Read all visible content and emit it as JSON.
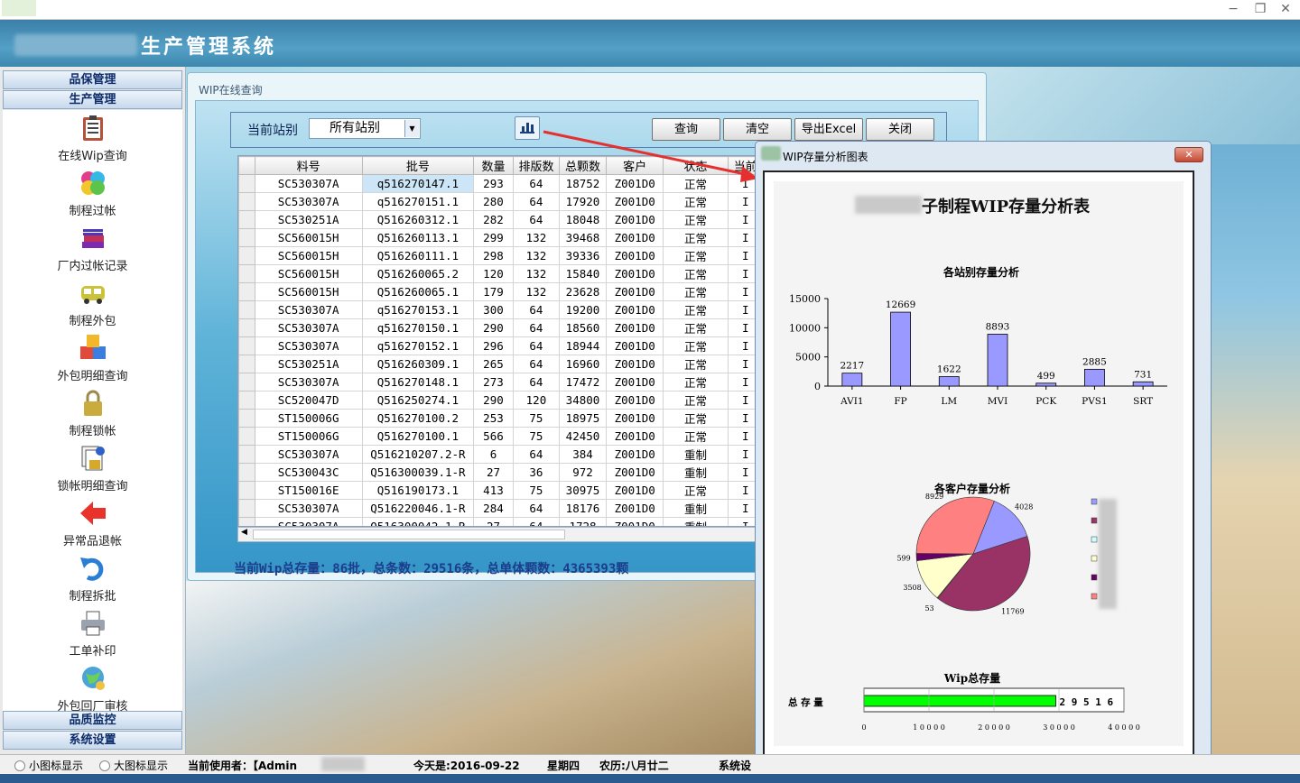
{
  "app": {
    "title": "生产管理系统"
  },
  "sidebar": {
    "sections_top": [
      "品保管理",
      "生产管理"
    ],
    "items": [
      {
        "label": "在线Wip查询",
        "icon": "clipboard-icon"
      },
      {
        "label": "制程过帐",
        "icon": "colored-petals-icon"
      },
      {
        "label": "厂内过帐记录",
        "icon": "book-stack-icon"
      },
      {
        "label": "制程外包",
        "icon": "truck-icon"
      },
      {
        "label": "外包明细查询",
        "icon": "abc-blocks-icon"
      },
      {
        "label": "制程锁帐",
        "icon": "padlock-icon"
      },
      {
        "label": "锁帐明细查询",
        "icon": "locked-documents-icon"
      },
      {
        "label": "异常品退帐",
        "icon": "red-arrow-left-icon"
      },
      {
        "label": "制程拆批",
        "icon": "undo-arrow-icon"
      },
      {
        "label": "工单补印",
        "icon": "printer-icon"
      },
      {
        "label": "外包回厂审核",
        "icon": "globe-people-icon"
      }
    ],
    "sections_bottom": [
      "品质监控",
      "系统设置"
    ]
  },
  "wip": {
    "window_title": "WIP在线查询",
    "station_label": "当前站别",
    "station_value": "所有站别",
    "buttons": {
      "query": "查询",
      "clear": "清空",
      "export": "导出Excel",
      "close": "关闭"
    },
    "columns": [
      "料号",
      "批号",
      "数量",
      "排版数",
      "总颗数",
      "客户",
      "状态",
      "当前"
    ],
    "rows": [
      [
        "SC530307A",
        "q516270147.1",
        "293",
        "64",
        "18752",
        "Z001D0",
        "正常",
        "I"
      ],
      [
        "SC530307A",
        "q516270151.1",
        "280",
        "64",
        "17920",
        "Z001D0",
        "正常",
        "I"
      ],
      [
        "SC530251A",
        "Q516260312.1",
        "282",
        "64",
        "18048",
        "Z001D0",
        "正常",
        "I"
      ],
      [
        "SC560015H",
        "Q516260113.1",
        "299",
        "132",
        "39468",
        "Z001D0",
        "正常",
        "I"
      ],
      [
        "SC560015H",
        "Q516260111.1",
        "298",
        "132",
        "39336",
        "Z001D0",
        "正常",
        "I"
      ],
      [
        "SC560015H",
        "Q516260065.2",
        "120",
        "132",
        "15840",
        "Z001D0",
        "正常",
        "I"
      ],
      [
        "SC560015H",
        "Q516260065.1",
        "179",
        "132",
        "23628",
        "Z001D0",
        "正常",
        "I"
      ],
      [
        "SC530307A",
        "q516270153.1",
        "300",
        "64",
        "19200",
        "Z001D0",
        "正常",
        "I"
      ],
      [
        "SC530307A",
        "q516270150.1",
        "290",
        "64",
        "18560",
        "Z001D0",
        "正常",
        "I"
      ],
      [
        "SC530307A",
        "q516270152.1",
        "296",
        "64",
        "18944",
        "Z001D0",
        "正常",
        "I"
      ],
      [
        "SC530251A",
        "Q516260309.1",
        "265",
        "64",
        "16960",
        "Z001D0",
        "正常",
        "I"
      ],
      [
        "SC530307A",
        "Q516270148.1",
        "273",
        "64",
        "17472",
        "Z001D0",
        "正常",
        "I"
      ],
      [
        "SC520047D",
        "Q516250274.1",
        "290",
        "120",
        "34800",
        "Z001D0",
        "正常",
        "I"
      ],
      [
        "ST150006G",
        "Q516270100.2",
        "253",
        "75",
        "18975",
        "Z001D0",
        "正常",
        "I"
      ],
      [
        "ST150006G",
        "Q516270100.1",
        "566",
        "75",
        "42450",
        "Z001D0",
        "正常",
        "I"
      ],
      [
        "SC530307A",
        "Q516210207.2-R",
        "6",
        "64",
        "384",
        "Z001D0",
        "重制",
        "I"
      ],
      [
        "SC530043C",
        "Q516300039.1-R",
        "27",
        "36",
        "972",
        "Z001D0",
        "重制",
        "I"
      ],
      [
        "ST150016E",
        "Q516190173.1",
        "413",
        "75",
        "30975",
        "Z001D0",
        "正常",
        "I"
      ],
      [
        "SC530307A",
        "Q516220046.1-R",
        "284",
        "64",
        "18176",
        "Z001D0",
        "重制",
        "I"
      ],
      [
        "SC530307A",
        "Q516300042.1-R",
        "27",
        "64",
        "1728",
        "Z001D0",
        "重制",
        "I"
      ]
    ],
    "summary": "当前Wip总存量：86批，总条数：29516条，总单体颗数：4365393颗"
  },
  "chart_dialog": {
    "title": "WIP存量分析图表",
    "main_title": "子制程WIP存量分析表"
  },
  "chart_data": [
    {
      "type": "bar",
      "title": "各站别存量分析",
      "categories": [
        "AVI1",
        "FP",
        "LM",
        "MVI",
        "PCK",
        "PVS1",
        "SRT"
      ],
      "values": [
        2217,
        12669,
        1622,
        8893,
        499,
        2885,
        731
      ],
      "ylim": [
        0,
        15000
      ],
      "yticks": [
        0,
        5000,
        10000,
        15000
      ],
      "bar_color": "#9999ff"
    },
    {
      "type": "pie",
      "title": "各客户存量分析",
      "values": [
        4028,
        11769,
        53,
        3508,
        599,
        8929
      ],
      "colors": [
        "#9999ff",
        "#993366",
        "#ccffff",
        "#ffffcc",
        "#660066",
        "#ff8080"
      ]
    },
    {
      "type": "bar",
      "orientation": "horizontal",
      "title": "Wip总存量",
      "categories": [
        "总 存 量"
      ],
      "values": [
        29516
      ],
      "value_label": "2 9 5 1 6",
      "xlim": [
        0,
        40000
      ],
      "xticks": [
        "0",
        "1 0 0 0 0",
        "2 0 0 0 0",
        "3 0 0 0 0",
        "4 0 0 0 0"
      ],
      "bar_color": "#00ff00"
    }
  ],
  "statusbar": {
    "small_icon": "小图标显示",
    "large_icon": "大图标显示",
    "current_user": "当前使用者：【Admin",
    "today": "今天是:2016-09-22",
    "weekday": "星期四",
    "lunar": "农历:八月廿二",
    "system": "系统设"
  },
  "colors": {
    "header": "#4793bb",
    "accent_arrow": "#e53030",
    "bar": "#9999ff",
    "total_bar": "#00ff00"
  }
}
